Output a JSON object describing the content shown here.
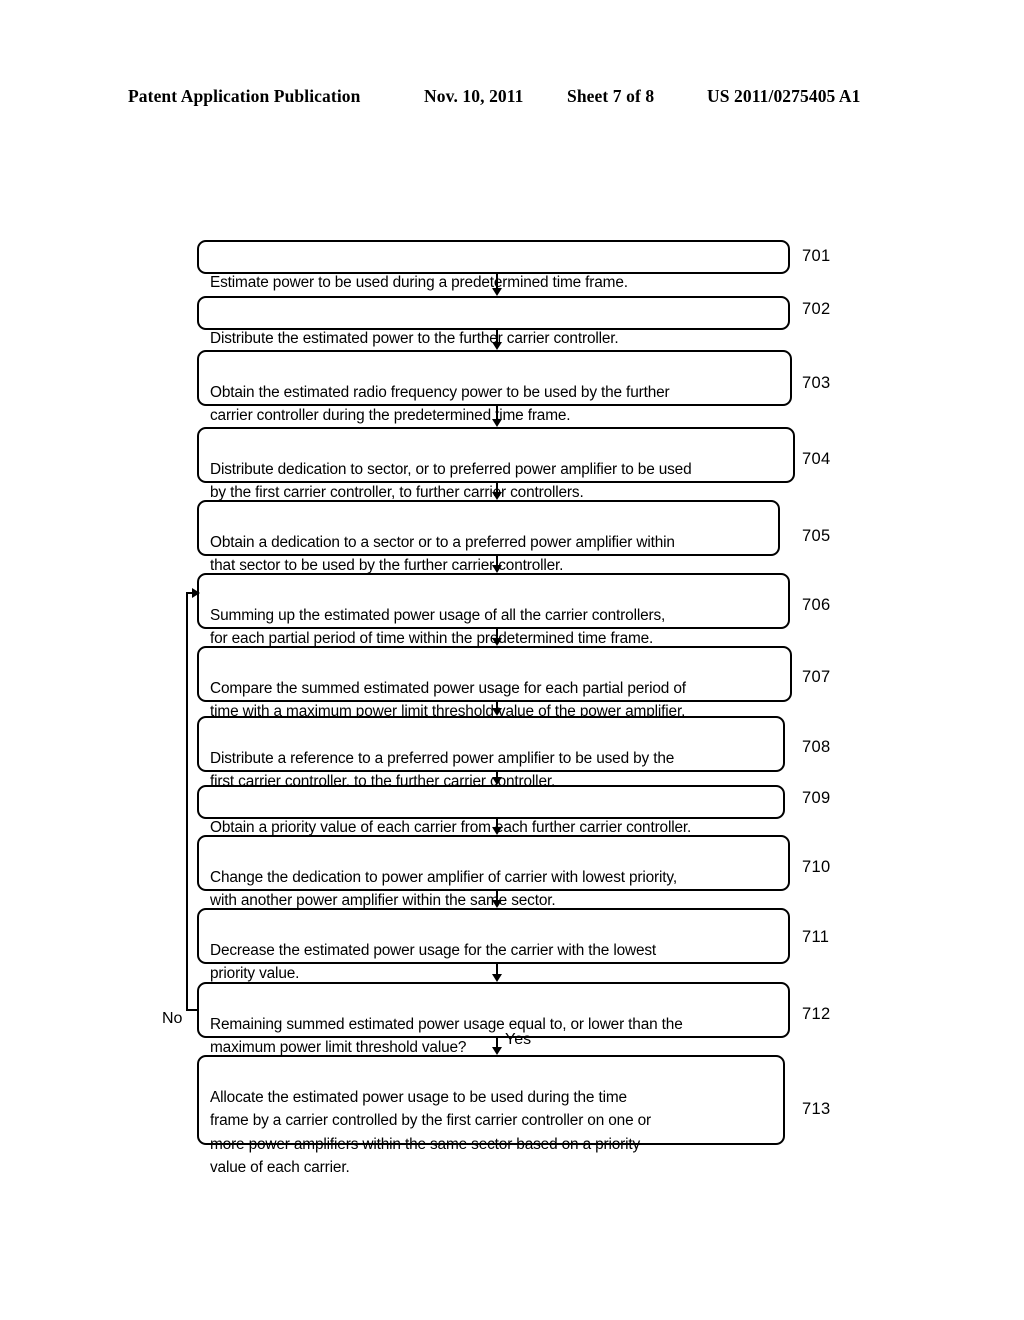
{
  "header": {
    "publication": "Patent Application Publication",
    "date": "Nov. 10, 2011",
    "sheet": "Sheet 7 of 8",
    "pub_number": "US 2011/0275405 A1"
  },
  "flowchart": {
    "branch_labels": {
      "no": "No",
      "yes": "Yes"
    },
    "steps": [
      {
        "ref": "701",
        "text": "Estimate power to be used during a predetermined time frame."
      },
      {
        "ref": "702",
        "text": "Distribute the estimated power to the further carrier controller."
      },
      {
        "ref": "703",
        "text": "Obtain the estimated radio frequency power to be used by the further\ncarrier controller during the predetermined time frame."
      },
      {
        "ref": "704",
        "text": "Distribute dedication to sector, or to preferred power amplifier to be used\nby the first carrier controller, to further carrier controllers."
      },
      {
        "ref": "705",
        "text": "Obtain a dedication to a sector or to a preferred power amplifier within\nthat sector to be used by the further carrier controller."
      },
      {
        "ref": "706",
        "text": "Summing up the estimated power usage of all the carrier controllers,\nfor each partial period of time within the predetermined time frame."
      },
      {
        "ref": "707",
        "text": "Compare the summed estimated power usage for each partial period of\ntime with a maximum power limit threshold value of the power amplifier."
      },
      {
        "ref": "708",
        "text": "Distribute a reference to a preferred power amplifier to be used by the\nfirst carrier controller, to the further carrier controller."
      },
      {
        "ref": "709",
        "text": "Obtain a priority value of each carrier from each further carrier controller."
      },
      {
        "ref": "710",
        "text": "Change the dedication to power amplifier of carrier with lowest priority,\nwith another power amplifier within the same sector."
      },
      {
        "ref": "711",
        "text": "Decrease the estimated power usage for the carrier with the lowest\npriority value."
      },
      {
        "ref": "712",
        "text": "Remaining summed estimated power usage equal to, or lower than the\nmaximum power limit threshold value?"
      },
      {
        "ref": "713",
        "text": "Allocate the estimated power usage to be used during the time\nframe by a carrier controlled by the first carrier controller on one or\nmore power amplifiers within the same sector based on a priority\nvalue of each carrier."
      }
    ]
  }
}
